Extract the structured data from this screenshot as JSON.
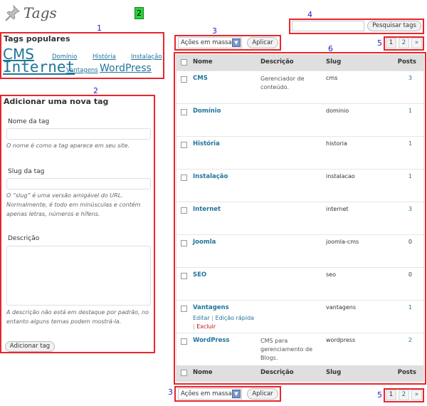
{
  "page": {
    "title": "Tags"
  },
  "annotations": {
    "n1": "1",
    "n2": "2",
    "n3_top": "3",
    "n3_bottom": "3",
    "n4": "4",
    "n5_top": "5",
    "n5_bottom": "5",
    "n6": "6",
    "badge": "2"
  },
  "colors": {
    "accent": "#21759b",
    "annotation_border": "#e8262c",
    "annotation_number": "#2424c8",
    "badge": "#27d33b",
    "delete": "#bc0b0b"
  },
  "tag_cloud": {
    "title": "Tags populares",
    "tags": [
      {
        "label": "CMS",
        "size": "large"
      },
      {
        "label": "Domínio",
        "size": "small"
      },
      {
        "label": "História",
        "size": "small"
      },
      {
        "label": "Instalação",
        "size": "small"
      },
      {
        "label": "Internet",
        "size": "largest"
      },
      {
        "label": "Vantagens",
        "size": "small"
      },
      {
        "label": "WordPress",
        "size": "medium"
      }
    ]
  },
  "add_tag": {
    "title": "Adicionar uma nova tag",
    "name_label": "Nome da tag",
    "name_hint": "O nome é como a tag aparece em seu site.",
    "slug_label": "Slug da tag",
    "slug_hint": "O “slug” é uma versão amigável do URL. Normalmente, é todo em minúsculas e contém apenas letras, números e hífens.",
    "desc_label": "Descrição",
    "desc_hint": "A descrição não está em destaque por padrão, no entanto alguns temas podem mostrá-la.",
    "submit": "Adicionar tag"
  },
  "bulk": {
    "selected": "Ações em massa",
    "apply": "Aplicar"
  },
  "search": {
    "value": "",
    "button": "Pesquisar tags"
  },
  "pagination": {
    "current": "1",
    "page2": "2",
    "next": "»"
  },
  "table": {
    "columns": {
      "name": "Nome",
      "desc": "Descrição",
      "slug": "Slug",
      "posts": "Posts"
    },
    "rows": [
      {
        "name": "CMS",
        "desc": "Gerenciador de conteúdo.",
        "slug": "cms",
        "posts": "3"
      },
      {
        "name": "Domínio",
        "desc": "",
        "slug": "dominio",
        "posts": "1"
      },
      {
        "name": "História",
        "desc": "",
        "slug": "historia",
        "posts": "1"
      },
      {
        "name": "Instalação",
        "desc": "",
        "slug": "instalacao",
        "posts": "1"
      },
      {
        "name": "Internet",
        "desc": "",
        "slug": "internet",
        "posts": "3"
      },
      {
        "name": "Joomla",
        "desc": "",
        "slug": "joomla-cms",
        "posts": "0"
      },
      {
        "name": "SEO",
        "desc": "",
        "slug": "seo",
        "posts": "0"
      },
      {
        "name": "Vantagens",
        "desc": "",
        "slug": "vantagens",
        "posts": "1"
      },
      {
        "name": "WordPress",
        "desc": "CMS para gerenciamento de Blogs.",
        "slug": "wordpress",
        "posts": "2"
      }
    ],
    "row_actions": {
      "edit": "Editar",
      "sep": "|",
      "quick_edit": "Edição rápida",
      "delete": "Excluir"
    }
  }
}
